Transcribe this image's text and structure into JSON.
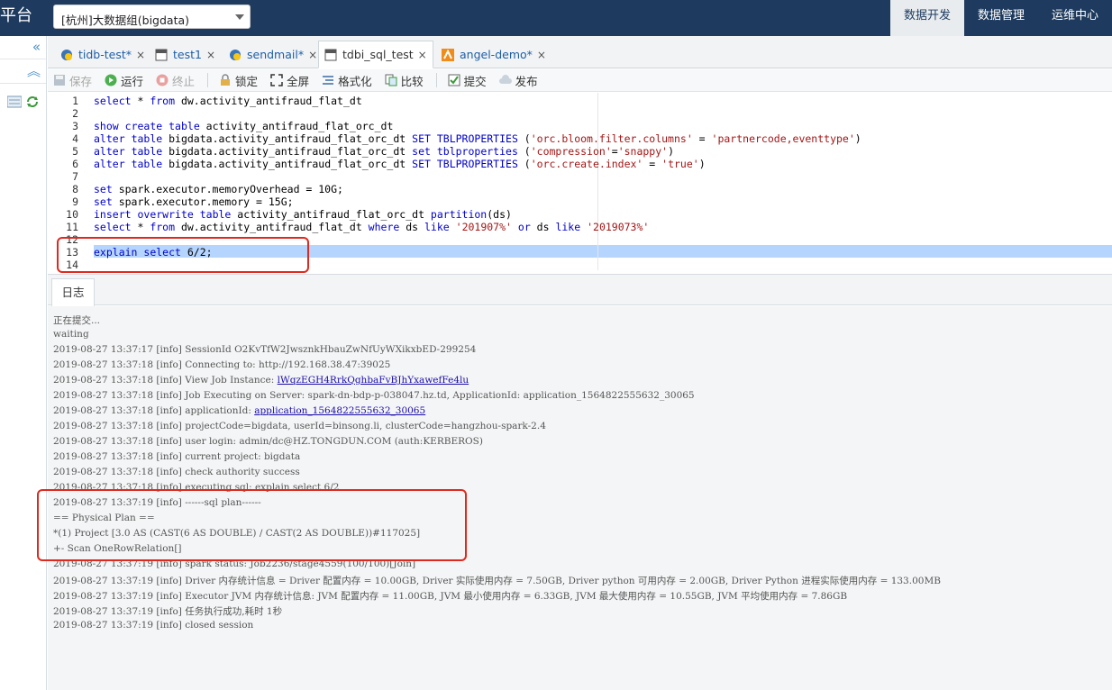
{
  "topbar": {
    "brand": "平台",
    "group_select": "[杭州]大数据组(bigdata)",
    "nav": [
      "数据开发",
      "数据管理",
      "运维中心"
    ]
  },
  "leftrail": {
    "collapse_icon": "double-chevron-left-icon",
    "up_icon": "double-chevron-up-icon"
  },
  "tabs": [
    {
      "label": "tidb-test*",
      "icon": "python-icon"
    },
    {
      "label": "test1",
      "icon": "sql-icon"
    },
    {
      "label": "sendmail*",
      "icon": "python-icon"
    },
    {
      "label": "tdbi_sql_test",
      "icon": "sql-icon"
    },
    {
      "label": "angel-demo*",
      "icon": "angel-icon"
    }
  ],
  "toolbar": {
    "save": "保存",
    "run": "运行",
    "stop": "终止",
    "lock": "锁定",
    "fullscreen": "全屏",
    "format": "格式化",
    "compare": "比较",
    "submit": "提交",
    "publish": "发布"
  },
  "editor": {
    "line_numbers": [
      "1",
      "2",
      "3",
      "4",
      "5",
      "6",
      "7",
      "8",
      "9",
      "10",
      "11",
      "12",
      "13",
      "14"
    ],
    "lines": [
      "select * from dw.activity_antifraud_flat_dt",
      "",
      "show create table activity_antifraud_flat_orc_dt",
      "alter table bigdata.activity_antifraud_flat_orc_dt SET TBLPROPERTIES ('orc.bloom.filter.columns' = 'partnercode,eventtype')",
      "alter table bigdata.activity_antifraud_flat_orc_dt set tblproperties ('compression'='snappy')",
      "alter table bigdata.activity_antifraud_flat_orc_dt SET TBLPROPERTIES ('orc.create.index' = 'true')",
      "",
      "set spark.executor.memoryOverhead = 10G;",
      "set spark.executor.memory = 15G;",
      "insert overwrite table activity_antifraud_flat_orc_dt partition(ds)",
      "select * from dw.activity_antifraud_flat_dt where ds like '201907%' or ds like '2019073%'",
      "",
      "explain select 6/2;",
      ""
    ],
    "selected_line": 13
  },
  "log": {
    "tab_label": "日志",
    "lines": [
      "正在提交...",
      "waiting",
      "2019-08-27 13:37:17 [info] SessionId O2KvTfW2JwsznkHbauZwNfUyWXikxbED-299254",
      "2019-08-27 13:37:18 [info] Connecting to: http://192.168.38.47:39025",
      "2019-08-27 13:37:18 [info] View Job Instance: ",
      "2019-08-27 13:37:18 [info] Job Executing on Server: spark-dn-bdp-p-038047.hz.td, ApplicationId: application_1564822555632_30065",
      "2019-08-27 13:37:18 [info] applicationId: ",
      "2019-08-27 13:37:18 [info] projectCode=bigdata, userId=binsong.li, clusterCode=hangzhou-spark-2.4",
      "2019-08-27 13:37:18 [info] user login: admin/dc@HZ.TONGDUN.COM (auth:KERBEROS)",
      "2019-08-27 13:37:18 [info] current project: bigdata",
      "2019-08-27 13:37:18 [info] check authority success",
      "2019-08-27 13:37:18 [info] executing sql: explain select 6/2",
      "2019-08-27 13:37:19 [info] ------sql plan------",
      "== Physical Plan ==",
      "*(1) Project [3.0 AS (CAST(6 AS DOUBLE) / CAST(2 AS DOUBLE))#117025]",
      "+- Scan OneRowRelation[]",
      "2019-08-27 13:37:19 [info] spark status: Job2236/stage4559(100/100)[Join]",
      "2019-08-27 13:37:19 [info] Driver 内存统计信息 = Driver 配置内存 = 10.00GB, Driver 实际使用内存 = 7.50GB, Driver python 可用内存 = 2.00GB, Driver Python 进程实际使用内存 = 133.00MB",
      "2019-08-27 13:37:19 [info] Executor JVM 内存统计信息: JVM 配置内存 = 11.00GB, JVM 最小使用内存 = 6.33GB, JVM 最大使用内存 = 10.55GB, JVM 平均使用内存 = 7.86GB",
      "2019-08-27 13:37:19 [info] 任务执行成功,耗时 1秒",
      "2019-08-27 13:37:19 [info] closed session"
    ],
    "job_instance_link": "lWqzEGH4RrkQghbaFvBJhYxawefFe4lu",
    "application_link": "application_1564822555632_30065"
  },
  "colors": {
    "topbar": "#1e3b5f",
    "selection": "#b5d5ff",
    "annotation": "#e0291e"
  }
}
